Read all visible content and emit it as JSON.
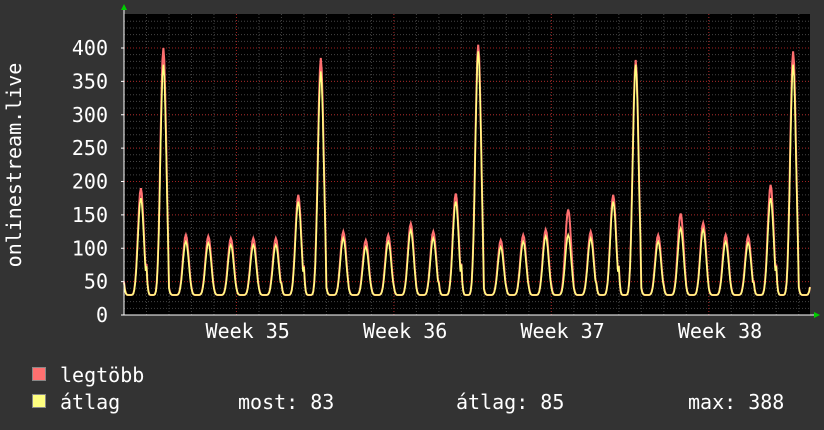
{
  "chart_data": {
    "type": "line",
    "ylabel": "onlinestream.live",
    "ylim": [
      0,
      400
    ],
    "yticks": [
      0,
      50,
      100,
      150,
      200,
      250,
      300,
      350,
      400
    ],
    "xticks": [
      {
        "label": "Week 35",
        "day": 5
      },
      {
        "label": "Week 36",
        "day": 12
      },
      {
        "label": "Week 37",
        "day": 19
      },
      {
        "label": "Week 38",
        "day": 26
      }
    ],
    "days": 30.5,
    "grid": true,
    "series": [
      {
        "name": "legtöbb",
        "color": "#ff7070",
        "daily_peaks": [
          190,
          400,
          120,
          118,
          115,
          115,
          115,
          180,
          385,
          125,
          112,
          120,
          137,
          125,
          182,
          405,
          112,
          120,
          128,
          158,
          125,
          180,
          382,
          120,
          152,
          138,
          120,
          118,
          195,
          395,
          127
        ]
      },
      {
        "name": "átlag",
        "color": "#ffff80",
        "daily_peaks": [
          175,
          375,
          110,
          108,
          105,
          105,
          105,
          170,
          365,
          115,
          102,
          110,
          127,
          115,
          170,
          395,
          102,
          110,
          118,
          120,
          115,
          170,
          375,
          110,
          130,
          128,
          110,
          108,
          175,
          375,
          122
        ]
      }
    ]
  },
  "legend": {
    "max_label": "legtöbb",
    "avg_label": "átlag",
    "max_color": "#ff7070",
    "avg_color": "#ffff80"
  },
  "stats": {
    "current": "most: 83",
    "average": "átlag: 85",
    "maximum": "max: 388"
  }
}
